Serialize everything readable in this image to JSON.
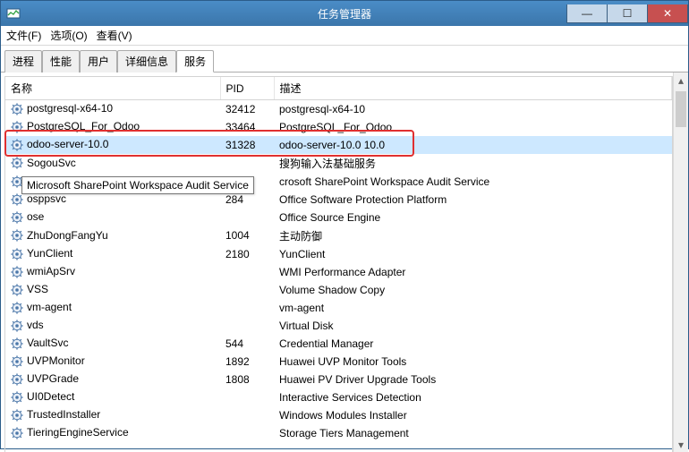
{
  "window": {
    "title": "任务管理器",
    "min": "—",
    "max": "☐",
    "close": "✕"
  },
  "menu": {
    "file": "文件(F)",
    "options": "选项(O)",
    "view": "查看(V)"
  },
  "tabs": [
    {
      "label": "进程"
    },
    {
      "label": "性能"
    },
    {
      "label": "用户"
    },
    {
      "label": "详细信息"
    },
    {
      "label": "服务"
    }
  ],
  "columns": {
    "name": "名称",
    "pid": "PID",
    "desc": "描述"
  },
  "tooltip": "Microsoft SharePoint Workspace Audit Service",
  "services": [
    {
      "name": "postgresql-x64-10",
      "pid": "32412",
      "desc": "postgresql-x64-10"
    },
    {
      "name": "PostgreSQL_For_Odoo",
      "pid": "33464",
      "desc": "PostgreSQL_For_Odoo"
    },
    {
      "name": "odoo-server-10.0",
      "pid": "31328",
      "desc": "odoo-server-10.0 10.0"
    },
    {
      "name": "SogouSvc",
      "pid": "",
      "desc": "搜狗输入法基础服务"
    },
    {
      "name": "",
      "pid": "",
      "desc": "crosoft SharePoint Workspace Audit Service"
    },
    {
      "name": "osppsvc",
      "pid": "284",
      "desc": "Office Software Protection Platform"
    },
    {
      "name": "ose",
      "pid": "",
      "desc": "Office  Source Engine"
    },
    {
      "name": "ZhuDongFangYu",
      "pid": "1004",
      "desc": "主动防御"
    },
    {
      "name": "YunClient",
      "pid": "2180",
      "desc": "YunClient"
    },
    {
      "name": "wmiApSrv",
      "pid": "",
      "desc": "WMI Performance Adapter"
    },
    {
      "name": "VSS",
      "pid": "",
      "desc": "Volume Shadow Copy"
    },
    {
      "name": "vm-agent",
      "pid": "",
      "desc": "vm-agent"
    },
    {
      "name": "vds",
      "pid": "",
      "desc": "Virtual Disk"
    },
    {
      "name": "VaultSvc",
      "pid": "544",
      "desc": "Credential Manager"
    },
    {
      "name": "UVPMonitor",
      "pid": "1892",
      "desc": "Huawei UVP Monitor Tools"
    },
    {
      "name": "UVPGrade",
      "pid": "1808",
      "desc": "Huawei PV Driver Upgrade Tools"
    },
    {
      "name": "UI0Detect",
      "pid": "",
      "desc": "Interactive Services Detection"
    },
    {
      "name": "TrustedInstaller",
      "pid": "",
      "desc": "Windows Modules Installer"
    },
    {
      "name": "TieringEngineService",
      "pid": "",
      "desc": "Storage Tiers Management"
    }
  ]
}
